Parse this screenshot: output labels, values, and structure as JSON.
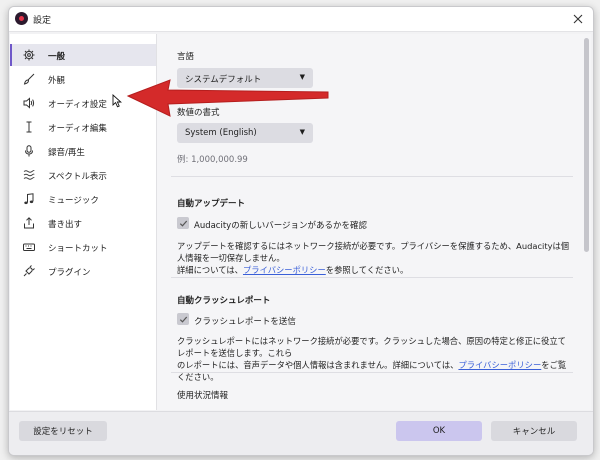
{
  "window": {
    "title": "設定"
  },
  "sidebar": {
    "items": [
      {
        "label": "一般",
        "icon": "gear-icon",
        "active": true
      },
      {
        "label": "外観",
        "icon": "brush-icon"
      },
      {
        "label": "オーディオ設定",
        "icon": "speaker-icon"
      },
      {
        "label": "オーディオ編集",
        "icon": "text-cursor-icon"
      },
      {
        "label": "録音/再生",
        "icon": "microphone-icon"
      },
      {
        "label": "スペクトル表示",
        "icon": "spectrum-icon"
      },
      {
        "label": "ミュージック",
        "icon": "music-note-icon"
      },
      {
        "label": "書き出す",
        "icon": "export-icon"
      },
      {
        "label": "ショートカット",
        "icon": "keyboard-icon"
      },
      {
        "label": "プラグイン",
        "icon": "plug-icon"
      }
    ]
  },
  "main": {
    "language": {
      "label": "言語",
      "value": "システムデフォルト"
    },
    "number_format": {
      "label": "数値の書式",
      "value": "System (English)",
      "example": "例: 1,000,000.99"
    },
    "auto_update": {
      "heading": "自動アップデート",
      "checkbox_label": "Audacityの新しいバージョンがあるかを確認",
      "checked": true,
      "desc_line1": "アップデートを確認するにはネットワーク接続が必要です。プライバシーを保護するため、Audacityは個人情報を一切保存しません。",
      "desc_line2_prefix": "詳細については、",
      "link": "プライバシーポリシー",
      "desc_line2_suffix": "を参照してください。"
    },
    "crash_report": {
      "heading": "自動クラッシュレポート",
      "checkbox_label": "クラッシュレポートを送信",
      "checked": true,
      "desc_line1": "クラッシュレポートにはネットワーク接続が必要です。クラッシュした場合、原因の特定と修正に役立てレポートを送信します。これら",
      "desc_line2_prefix": "のレポートには、音声データや個人情報は含まれません。詳細については、",
      "link": "プライバシーポリシー",
      "desc_line2_suffix": "をご覧ください。"
    },
    "usage_info": {
      "heading": "使用状況情報"
    }
  },
  "footer": {
    "reset_label": "設定をリセット",
    "ok_label": "OK",
    "cancel_label": "キャンセル"
  },
  "colors": {
    "accent": "#6f58c9",
    "ok_button": "#cbc6ee",
    "annotation_arrow": "#d42a2a"
  }
}
